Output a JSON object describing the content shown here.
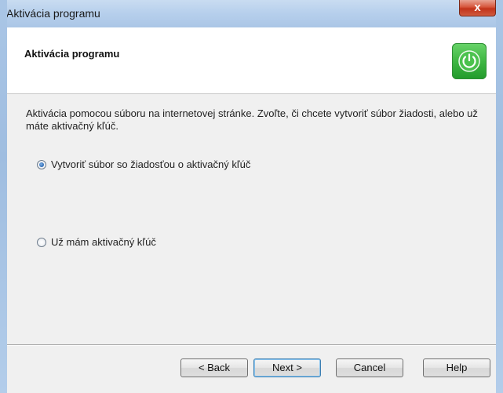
{
  "window": {
    "title": "Aktivácia programu",
    "close_glyph": "x"
  },
  "header": {
    "title": "Aktivácia programu",
    "icon": "power-icon",
    "icon_color": "#3fb743"
  },
  "description": "Aktivácia pomocou súboru na internetovej stránke. Zvoľte, či chcete vytvoriť súbor žiadosti, alebo už máte aktivačný kľúč.",
  "options": [
    {
      "label": "Vytvoriť súbor so žiadosťou o aktivačný kľúč",
      "selected": true
    },
    {
      "label": "Už mám aktivačný kľúč",
      "selected": false
    }
  ],
  "buttons": {
    "back": "< Back",
    "next": "Next >",
    "cancel": "Cancel",
    "help": "Help"
  }
}
